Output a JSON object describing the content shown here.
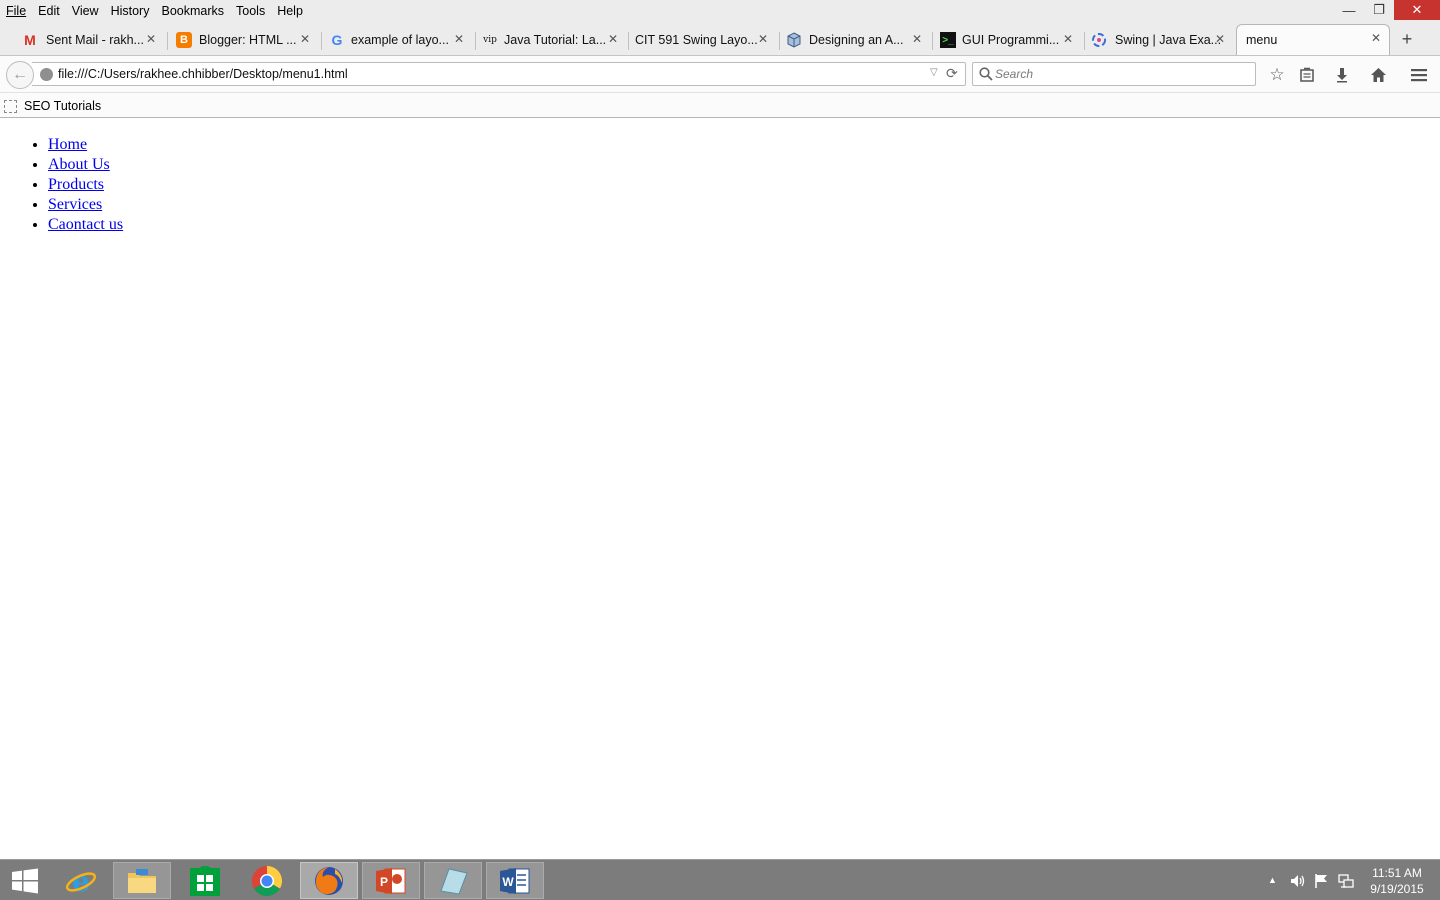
{
  "menubar": {
    "items": [
      {
        "label": "File"
      },
      {
        "label": "Edit"
      },
      {
        "label": "View"
      },
      {
        "label": "History"
      },
      {
        "label": "Bookmarks"
      },
      {
        "label": "Tools"
      },
      {
        "label": "Help"
      }
    ]
  },
  "window_controls": {
    "minimize": "—",
    "restore": "❐",
    "close": "✕"
  },
  "tabs": [
    {
      "label": "Sent Mail - rakh...",
      "icon": "gmail-icon"
    },
    {
      "label": "Blogger: HTML ...",
      "icon": "blogger-icon"
    },
    {
      "label": "example of layo...",
      "icon": "google-icon"
    },
    {
      "label": "Java Tutorial: La...",
      "icon": "vip-icon",
      "icon_text": "vip"
    },
    {
      "label": "CIT 591 Swing Layo...",
      "icon": "blank-page-icon"
    },
    {
      "label": "Designing an A...",
      "icon": "cube-icon"
    },
    {
      "label": "GUI Programmi...",
      "icon": "terminal-icon"
    },
    {
      "label": "Swing | Java Exa...",
      "icon": "swirl-icon"
    },
    {
      "label": "menu",
      "icon": "blank-page-icon",
      "active": true
    }
  ],
  "new_tab": "+",
  "navbar": {
    "url": "file:///C:/Users/rakhee.chhibber/Desktop/menu1.html",
    "search_placeholder": "Search"
  },
  "bookmarks": [
    {
      "label": "SEO Tutorials"
    }
  ],
  "page": {
    "nav_links": [
      {
        "label": "Home"
      },
      {
        "label": "About Us"
      },
      {
        "label": "Products"
      },
      {
        "label": "Services"
      },
      {
        "label": "Caontact us"
      }
    ]
  },
  "taskbar": {
    "apps": [
      {
        "name": "windows-start-icon"
      },
      {
        "name": "internet-explorer-icon"
      },
      {
        "name": "file-explorer-icon"
      },
      {
        "name": "windows-store-icon"
      },
      {
        "name": "chrome-icon"
      },
      {
        "name": "firefox-icon",
        "active": true
      },
      {
        "name": "powerpoint-icon"
      },
      {
        "name": "app-icon"
      },
      {
        "name": "word-icon"
      }
    ],
    "clock_time": "11:51 AM",
    "clock_date": "9/19/2015"
  },
  "colors": {
    "link": "#0000ee",
    "taskbar": "#7c7c7c",
    "close_button": "#c7332e",
    "gmail_red": "#d93025",
    "blogger_orange": "#f57d00"
  }
}
